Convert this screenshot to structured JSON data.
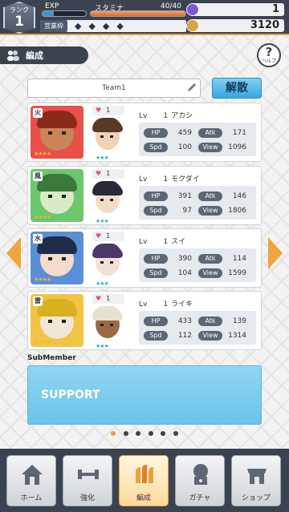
{
  "top": {
    "rank_label": "ランク",
    "rank_value": "1",
    "exp_label": "EXP",
    "exp_fraction": 0.25,
    "stamina_label": "スタミナ",
    "stamina_text": "40/40",
    "stamina_fraction": 1.0,
    "business_label": "営業枠",
    "business_marks": "◆◆◆◆",
    "gem_value": "1",
    "coin_value": "3120"
  },
  "header": {
    "title": "編成",
    "help_label": "ヘルプ"
  },
  "team": {
    "name": "Team1",
    "disband_label": "解散"
  },
  "members": [
    {
      "attr": "火",
      "stars": "★★★★",
      "sub_level": "1",
      "lv_label": "Lv",
      "lv": "1",
      "name": "アカシ",
      "hp": "459",
      "atk": "171",
      "spd": "100",
      "view": "1096",
      "sub_stars": "★★★",
      "main_hair": "#8a2a1a",
      "main_skin": "#c98458",
      "sub_hair": "#5a3a24",
      "sub_skin": "#f2d2b4",
      "bg": "#e8504a"
    },
    {
      "attr": "風",
      "stars": "★★★★",
      "sub_level": "1",
      "lv_label": "Lv",
      "lv": "1",
      "name": "モクダイ",
      "hp": "391",
      "atk": "146",
      "spd": "97",
      "view": "1806",
      "sub_stars": "★★★",
      "main_hair": "#3a7a3a",
      "main_skin": "#d9e8c8",
      "sub_hair": "#2a2a36",
      "sub_skin": "#f2dcc6",
      "bg": "#6cc76c"
    },
    {
      "attr": "水",
      "stars": "★★★★",
      "sub_level": "1",
      "lv_label": "Lv",
      "lv": "1",
      "name": "スイ",
      "hp": "390",
      "atk": "114",
      "spd": "104",
      "view": "1599",
      "sub_stars": "★★★",
      "main_hair": "#1f2d4a",
      "main_skin": "#f3dccb",
      "sub_hair": "#4a3a6a",
      "sub_skin": "#f2e0d2",
      "bg": "#5a8fd6"
    },
    {
      "attr": "雷",
      "stars": "★★★★",
      "sub_level": "1",
      "lv_label": "Lv",
      "lv": "1",
      "name": "ライキ",
      "hp": "433",
      "atk": "139",
      "spd": "112",
      "view": "1314",
      "sub_stars": "★★★",
      "main_hair": "#d8b020",
      "main_skin": "#efe6d6",
      "sub_hair": "#e8e0d0",
      "sub_skin": "#9a6a44",
      "bg": "#f2c443"
    }
  ],
  "stat_labels": {
    "hp": "HP",
    "atk": "Atk",
    "spd": "Spd",
    "view": "View"
  },
  "sub_member": {
    "label": "SubMember",
    "support_label": "SUPPORT"
  },
  "pager": {
    "count": 6,
    "active": 0
  },
  "nav": [
    {
      "label": "ホーム",
      "icon": "home-icon"
    },
    {
      "label": "強化",
      "icon": "dumbbell-icon"
    },
    {
      "label": "編成",
      "icon": "team-icon",
      "active": true
    },
    {
      "label": "ガチャ",
      "icon": "gacha-icon"
    },
    {
      "label": "ショップ",
      "icon": "shop-icon"
    }
  ],
  "colors": {
    "accent": "#e9a13a",
    "dark": "#3b4250",
    "support": "#7ccbee",
    "disband": "#4fb3e6"
  }
}
